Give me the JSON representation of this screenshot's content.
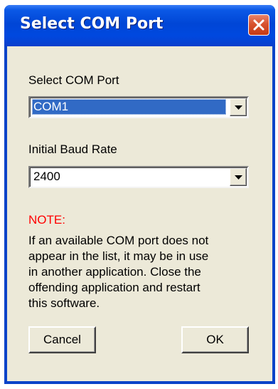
{
  "window": {
    "title": "Select COM Port"
  },
  "com_port": {
    "label": "Select COM Port",
    "selected_value": "COM1"
  },
  "baud_rate": {
    "label": "Initial Baud Rate",
    "selected_value": "2400"
  },
  "note": {
    "title": "NOTE:",
    "lines": [
      "If an available COM port does not",
      "appear in the list, it may be in use",
      "in another application.  Close the",
      "offending application and restart",
      "this software."
    ]
  },
  "buttons": {
    "cancel_label": "Cancel",
    "ok_label": "OK"
  },
  "icons": {
    "close": "close-icon",
    "dropdown": "chevron-down-icon"
  },
  "colors": {
    "titlebar": "#0046d6",
    "window_bg": "#ece9d8",
    "close_button": "#d8532f",
    "selection": "#316ac5",
    "note_title": "#ff0000"
  }
}
